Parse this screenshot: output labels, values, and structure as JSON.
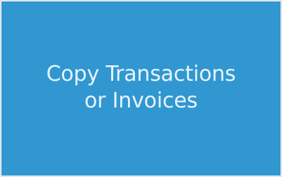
{
  "tile": {
    "line1": "Copy Transactions",
    "line2": "or Invoices",
    "background_color": "#3097d1",
    "text_color": "#e8f3fb"
  }
}
